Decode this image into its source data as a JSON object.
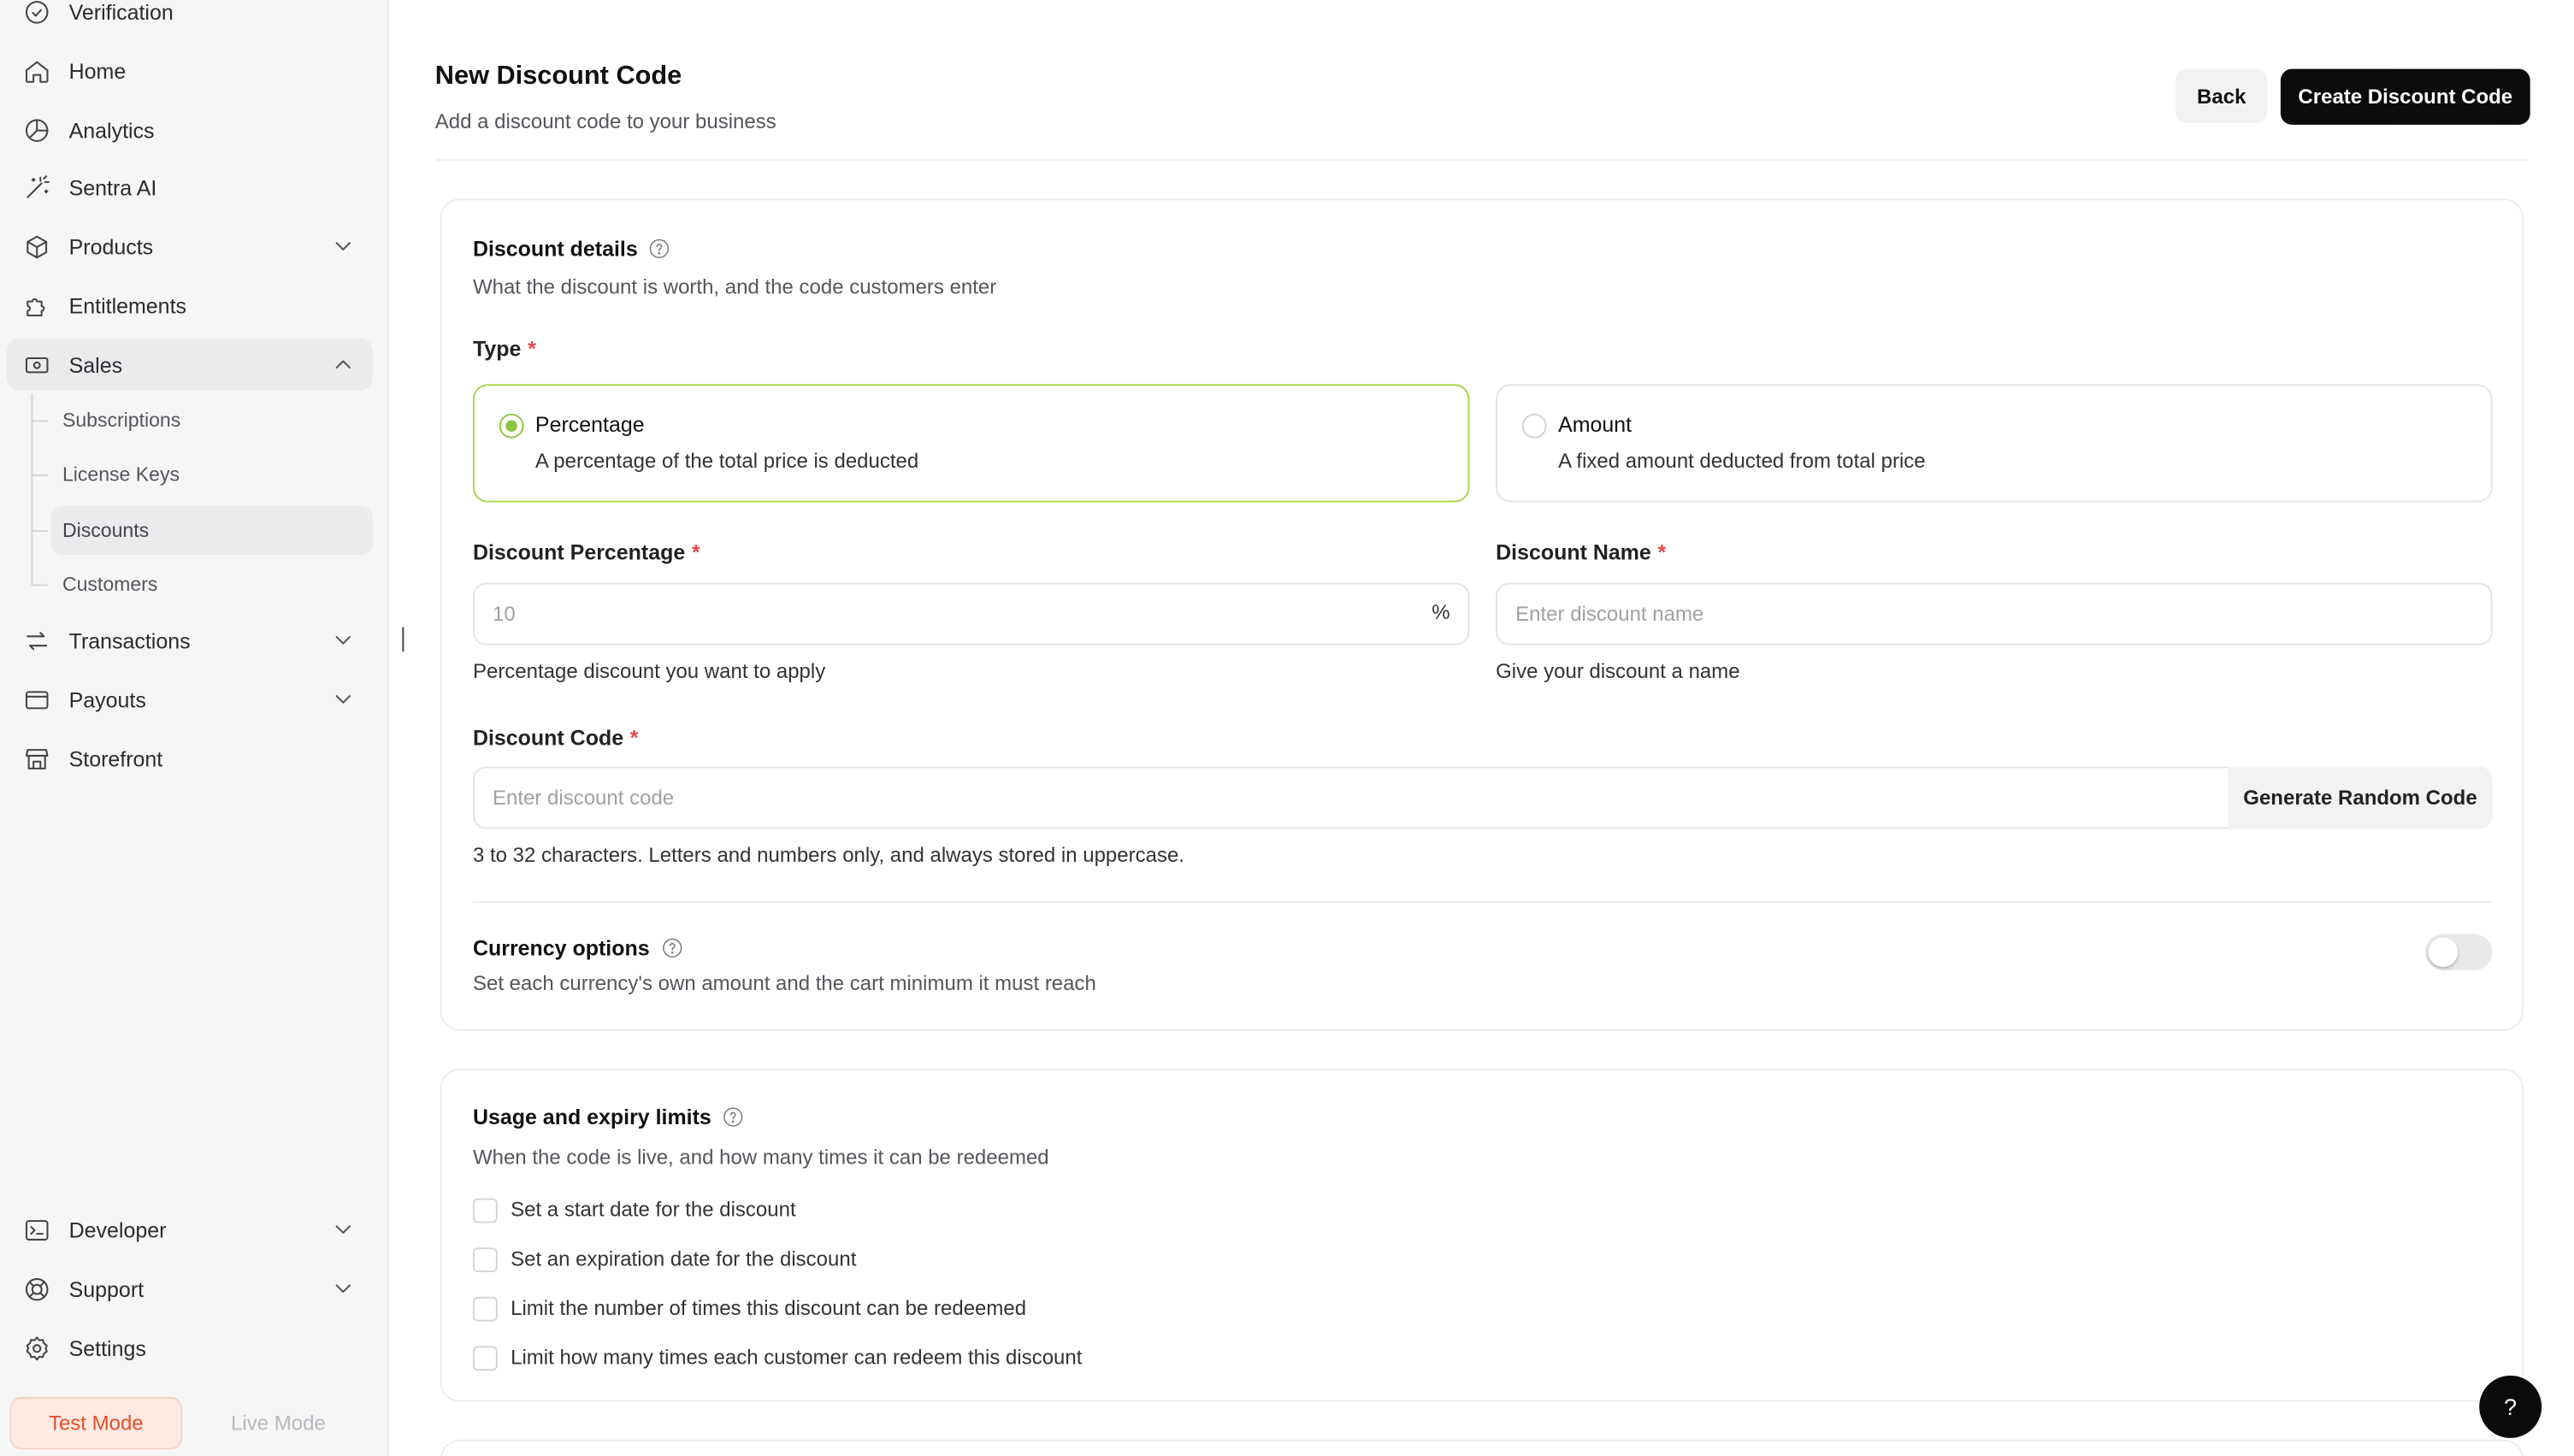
{
  "sidebar": {
    "items": [
      {
        "label": "Verification",
        "icon": "badge-check-icon"
      },
      {
        "label": "Home",
        "icon": "home-icon"
      },
      {
        "label": "Analytics",
        "icon": "analytics-icon"
      },
      {
        "label": "Sentra AI",
        "icon": "magic-wand-icon"
      },
      {
        "label": "Products",
        "icon": "box-icon"
      },
      {
        "label": "Entitlements",
        "icon": "puzzle-icon"
      },
      {
        "label": "Sales",
        "icon": "banknote-icon"
      },
      {
        "label": "Transactions",
        "icon": "arrows-left-right-icon"
      },
      {
        "label": "Payouts",
        "icon": "wallet-icon"
      },
      {
        "label": "Storefront",
        "icon": "store-icon"
      },
      {
        "label": "Developer",
        "icon": "terminal-icon"
      },
      {
        "label": "Support",
        "icon": "lifebuoy-icon"
      },
      {
        "label": "Settings",
        "icon": "gear-icon"
      }
    ],
    "sales_sub": [
      "Subscriptions",
      "License Keys",
      "Discounts",
      "Customers"
    ],
    "mode": {
      "test": "Test Mode",
      "live": "Live Mode"
    }
  },
  "header": {
    "title": "New Discount Code",
    "subtitle": "Add a discount code to your business",
    "back": "Back",
    "create": "Create Discount Code"
  },
  "details": {
    "title": "Discount details",
    "desc": "What the discount is worth, and the code customers enter",
    "type_label": "Type",
    "options": [
      {
        "title": "Percentage",
        "desc": "A percentage of the total price is deducted",
        "selected": true
      },
      {
        "title": "Amount",
        "desc": "A fixed amount deducted from total price",
        "selected": false
      }
    ],
    "percentage": {
      "label": "Discount Percentage",
      "placeholder": "10",
      "suffix": "%",
      "helper": "Percentage discount you want to apply"
    },
    "name": {
      "label": "Discount Name",
      "placeholder": "Enter discount name",
      "helper": "Give your discount a name"
    },
    "code": {
      "label": "Discount Code",
      "placeholder": "Enter discount code",
      "generate": "Generate Random Code",
      "helper": "3 to 32 characters. Letters and numbers only, and always stored in uppercase."
    },
    "currency": {
      "title": "Currency options",
      "desc": "Set each currency's own amount and the cart minimum it must reach",
      "enabled": false
    }
  },
  "usage": {
    "title": "Usage and expiry limits",
    "desc": "When the code is live, and how many times it can be redeemed",
    "options": [
      "Set a start date for the discount",
      "Set an expiration date for the discount",
      "Limit the number of times this discount can be redeemed",
      "Limit how many times each customer can redeem this discount"
    ]
  },
  "help_fab": "?",
  "required_mark": "*",
  "colors": {
    "accent": "#8cc63f",
    "primary": "#0b0b0c",
    "test_mode": "#e0502a"
  }
}
